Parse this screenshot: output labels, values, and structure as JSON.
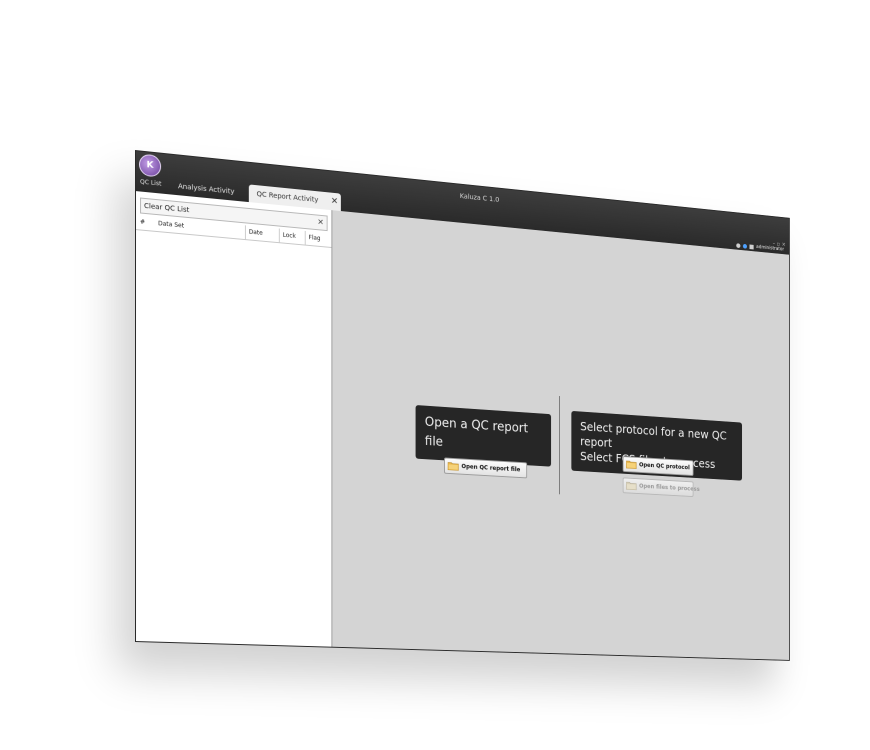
{
  "window": {
    "title": "Kaluza C 1.0"
  },
  "tabs": [
    {
      "label": "Analysis Activity"
    },
    {
      "label": "QC Report Activity",
      "close": "✕"
    }
  ],
  "window_controls": "– ▫ ×",
  "user": {
    "name": "administrator"
  },
  "left_panel": {
    "header": "QC List",
    "clear_label": "Clear QC List",
    "clear_icon": "✕",
    "columns": [
      "#",
      "Data Set",
      "Date",
      "Lock",
      "Flag"
    ]
  },
  "main": {
    "open_label": "Open a QC report file",
    "select_lines": [
      "Select protocol for a new QC report",
      "Select FCS files to process"
    ],
    "open_report_button": "Open QC report file",
    "open_protocol_button": "Open QC protocol",
    "open_files_button": "Open files to process"
  },
  "colors": {
    "titlebar": "#2a2a2a",
    "panel_bg": "#d4d4d4",
    "label_bg": "#262626"
  }
}
